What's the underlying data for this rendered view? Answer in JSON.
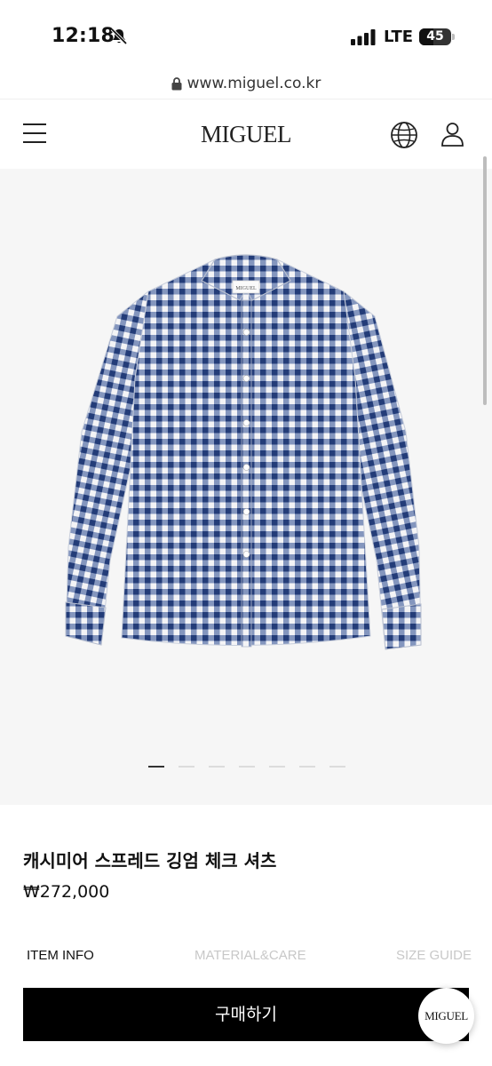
{
  "status_bar": {
    "time": "12:18",
    "network": "LTE",
    "battery": "45"
  },
  "browser": {
    "url": "www.miguel.co.kr"
  },
  "header": {
    "logo": "MIGUEL",
    "menu_icon": "hamburger-menu-icon",
    "language_icon": "globe-icon",
    "account_icon": "user-icon"
  },
  "gallery": {
    "image": "blue gingham check long-sleeve shirt",
    "shirt_label": "MIGUEL",
    "slide_count": 7,
    "active_slide": 1
  },
  "product": {
    "title": "캐시미어 스프레드 깅엄 체크 셔츠",
    "price": "₩272,000"
  },
  "tabs": [
    {
      "label": "ITEM INFO",
      "active": true
    },
    {
      "label": "MATERIAL&CARE",
      "active": false
    },
    {
      "label": "SIZE GUIDE",
      "active": false
    }
  ],
  "actions": {
    "buy_label": "구매하기",
    "chat_badge_label": "MIGUEL"
  },
  "colors": {
    "gingham_blue": "#2f4d8e",
    "buy_button_bg": "#000000",
    "gallery_bg": "#f6f6f6"
  }
}
